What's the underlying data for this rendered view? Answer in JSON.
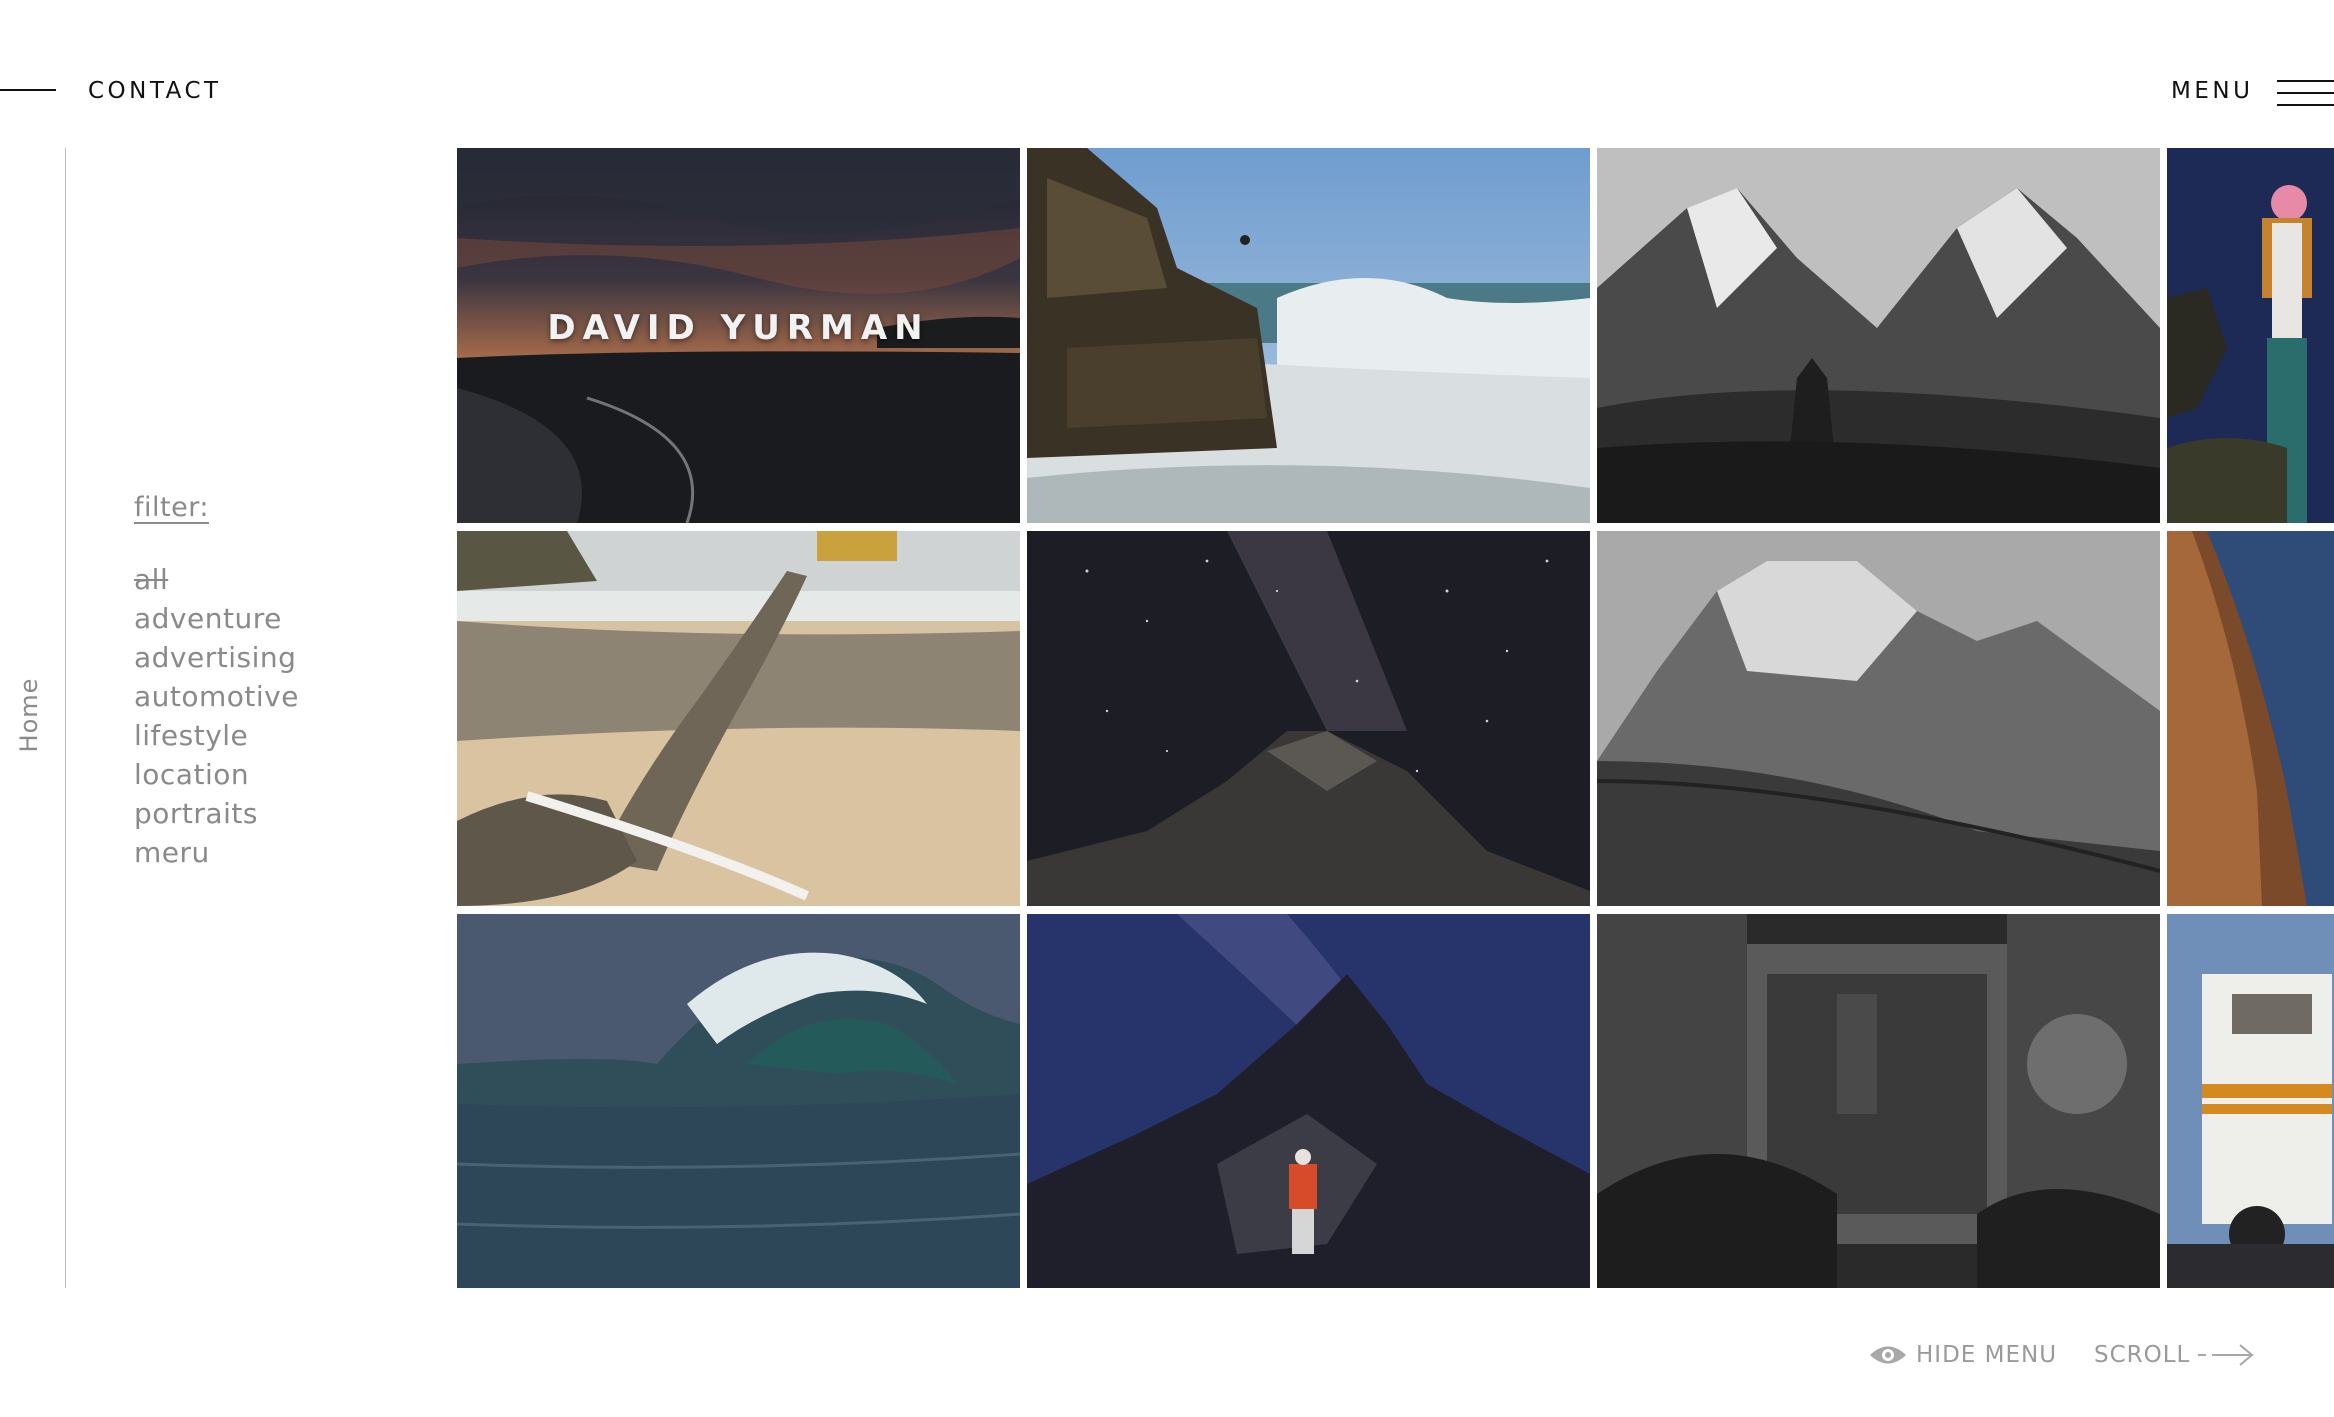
{
  "header": {
    "contact_label": "CONTACT",
    "menu_label": "MENU"
  },
  "sidebar": {
    "home_label": "Home",
    "filter_heading": "filter:",
    "filters": [
      {
        "label": "all",
        "active": true
      },
      {
        "label": "adventure",
        "active": false
      },
      {
        "label": "advertising",
        "active": false
      },
      {
        "label": "automotive",
        "active": false
      },
      {
        "label": "lifestyle",
        "active": false
      },
      {
        "label": "location",
        "active": false
      },
      {
        "label": "portraits",
        "active": false
      },
      {
        "label": "meru",
        "active": false
      }
    ]
  },
  "gallery": {
    "title_overlay": "DAVID YURMAN",
    "tiles": [
      {
        "name": "tile-sunset-beach-surfers",
        "icon": "photo"
      },
      {
        "name": "tile-surfer-cliff-wave",
        "icon": "photo"
      },
      {
        "name": "tile-himalaya-stupa-bw",
        "icon": "photo"
      },
      {
        "name": "tile-portrait-pink-beanie",
        "icon": "photo"
      },
      {
        "name": "tile-driftwood-beach",
        "icon": "photo"
      },
      {
        "name": "tile-milky-way-peak",
        "icon": "photo"
      },
      {
        "name": "tile-mountain-trekkers-bw",
        "icon": "photo"
      },
      {
        "name": "tile-red-rock-twilight",
        "icon": "photo"
      },
      {
        "name": "tile-curling-wave",
        "icon": "photo"
      },
      {
        "name": "tile-climber-night-summit",
        "icon": "photo"
      },
      {
        "name": "tile-monastery-monks-bw",
        "icon": "photo"
      },
      {
        "name": "tile-vintage-camper",
        "icon": "photo"
      }
    ]
  },
  "footer": {
    "hide_menu_label": "HIDE MENU",
    "hide_menu_icon": "eye-icon",
    "scroll_label": "SCROLL",
    "scroll_icon": "arrow-right-icon"
  },
  "colors": {
    "text": "#111111",
    "muted": "#8a8a8a",
    "background": "#ffffff"
  }
}
